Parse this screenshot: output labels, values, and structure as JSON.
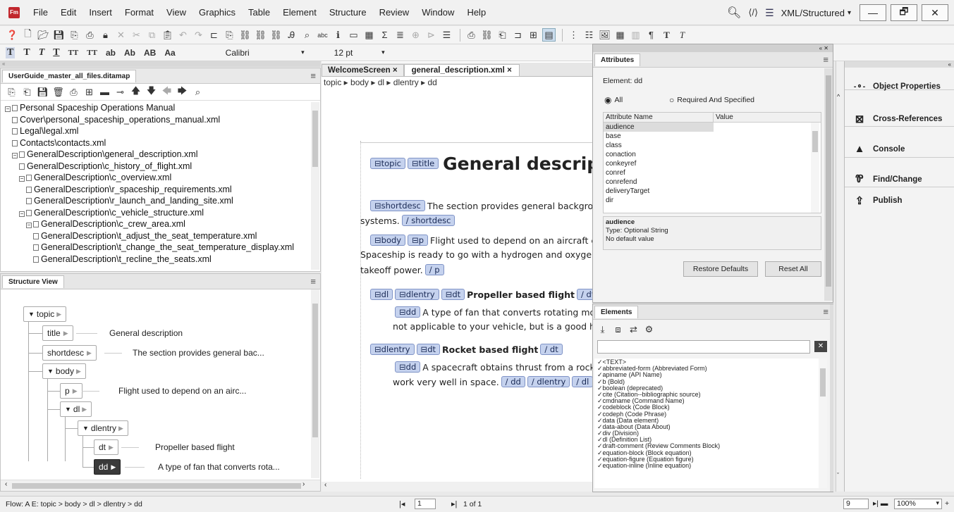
{
  "menu": {
    "items": [
      "File",
      "Edit",
      "Insert",
      "Format",
      "View",
      "Graphics",
      "Table",
      "Element",
      "Structure",
      "Review",
      "Window",
      "Help"
    ],
    "workspace": "XML/Structured",
    "min": "—",
    "max": "🗗",
    "close": "✕"
  },
  "format": {
    "buttons": [
      "T",
      "T",
      "T",
      "T",
      "ΤT",
      "TT",
      "ab",
      "Ab",
      "AB",
      "Aa"
    ],
    "font": "Calibri",
    "size": "12 pt"
  },
  "ditamap": {
    "tab": "UserGuide_master_all_files.ditamap",
    "items": [
      {
        "t": "Personal Spaceship Operations Manual",
        "lvl": 0,
        "tog": "⊟"
      },
      {
        "t": "Cover\\personal_spaceship_operations_manual.xml",
        "lvl": 1
      },
      {
        "t": "Legal\\legal.xml",
        "lvl": 1
      },
      {
        "t": "Contacts\\contacts.xml",
        "lvl": 1
      },
      {
        "t": "GeneralDescription\\general_description.xml",
        "lvl": 1,
        "tog": "⊟"
      },
      {
        "t": "GeneralDescription\\c_history_of_flight.xml",
        "lvl": 2
      },
      {
        "t": "GeneralDescription\\c_overview.xml",
        "lvl": 2,
        "tog": "⊟"
      },
      {
        "t": "GeneralDescription\\r_spaceship_requirements.xml",
        "lvl": 3
      },
      {
        "t": "GeneralDescription\\r_launch_and_landing_site.xml",
        "lvl": 3
      },
      {
        "t": "GeneralDescription\\c_vehicle_structure.xml",
        "lvl": 2,
        "tog": "⊟"
      },
      {
        "t": "GeneralDescription\\c_crew_area.xml",
        "lvl": 3,
        "tog": "⊟"
      },
      {
        "t": "GeneralDescription\\t_adjust_the_seat_temperature.xml",
        "lvl": 4
      },
      {
        "t": "GeneralDescription\\t_change_the_seat_temperature_display.xml",
        "lvl": 4
      },
      {
        "t": "GeneralDescription\\t_recline_the_seats.xml",
        "lvl": 4
      }
    ]
  },
  "structure": {
    "tab": "Structure View",
    "nodes": {
      "topic": "topic",
      "title": "title",
      "shortdesc": "shortdesc",
      "body": "body",
      "p": "p",
      "dl": "dl",
      "dlentry": "dlentry",
      "dt": "dt",
      "dd": "dd"
    },
    "texts": {
      "title": "General description",
      "shortdesc": "The section provides general bac...",
      "p": "Flight used to depend on an airc...",
      "dt": "Propeller based flight",
      "dd": "A type of fan that converts rota..."
    }
  },
  "tabs": {
    "welcome": "WelcomeScreen",
    "doc": "general_description.xml",
    "close": "×"
  },
  "breadcrumb": "topic ▸ body ▸ dl ▸ dlentry ▸ dd",
  "doc": {
    "title_tags": [
      "topic",
      "title"
    ],
    "title": "General descripti",
    "shortdesc_tag": "shortdesc",
    "shortdesc_1": "The section provides general backgrou",
    "shortdesc_2": "systems.",
    "shortdesc_end": "/ shortdesc",
    "body_tags": [
      "body",
      "p"
    ],
    "p_1": "Flight used to depend on an aircraft e",
    "p_2": "Spaceship is ready to go with a hydrogen and oxygen m",
    "p_3": "takeoff power.",
    "p_end": "/ p",
    "dl1_tags": [
      "dl",
      "dlentry",
      "dt"
    ],
    "dt1": "Propeller based flight",
    "dt_end": "/ dt",
    "dd1_tag": "dd",
    "dd1_1": "A type of fan that converts rotating mot",
    "dd1_2": "not applicable to your vehicle, but is a good hist",
    "dl2_tags": [
      "dlentry",
      "dt"
    ],
    "dt2": "Rocket based flight",
    "dd2_1": "A spacecraft obtains thrust from a rocket",
    "dd2_2": "work very well in space.",
    "dd2_ends": [
      "/ dd",
      "/ dlentry",
      "/ dl"
    ]
  },
  "attributes": {
    "title": "Attributes",
    "element": "Element: dd",
    "radio_all": "All",
    "radio_req": "Required And Specified",
    "col_name": "Attribute Name",
    "col_value": "Value",
    "rows": [
      "audience",
      "base",
      "class",
      "conaction",
      "conkeyref",
      "conref",
      "conrefend",
      "deliveryTarget",
      "dir"
    ],
    "info_name": "audience",
    "info_type": "Type: Optional String",
    "info_default": "No default value",
    "restore": "Restore Defaults",
    "reset": "Reset All"
  },
  "elements": {
    "title": "Elements",
    "items": [
      "✓<TEXT>",
      "✓abbreviated-form  (Abbreviated Form)",
      "✓apiname  (API Name)",
      "✓b  (Bold)",
      "✓boolean  (deprecated)",
      "✓cite  (Citation--bibliographic source)",
      "✓cmdname  (Command Name)",
      "✓codeblock  (Code Block)",
      "✓codeph  (Code Phrase)",
      "✓data  (Data element)",
      "✓data-about  (Data About)",
      "✓div  (Division)",
      "✓dl  (Definition List)",
      "✓draft-comment  (Review Comments Block)",
      "✓equation-block  (Block equation)",
      "✓equation-figure  (Equation figure)",
      "✓equation-inline  (Inline equation)"
    ]
  },
  "right_panel": {
    "items": [
      "Object Properties",
      "Cross-References",
      "Console",
      "Find/Change",
      "Publish"
    ],
    "icons": [
      "-⚬-",
      "⊠",
      "▲",
      "Ꮘ",
      "⇪"
    ]
  },
  "status": {
    "flow": "Flow: A  E: topic > body > dl > dlentry > dd",
    "page": "1",
    "of": "1 of 1",
    "zoom_field": "9",
    "zoom": "100%"
  }
}
